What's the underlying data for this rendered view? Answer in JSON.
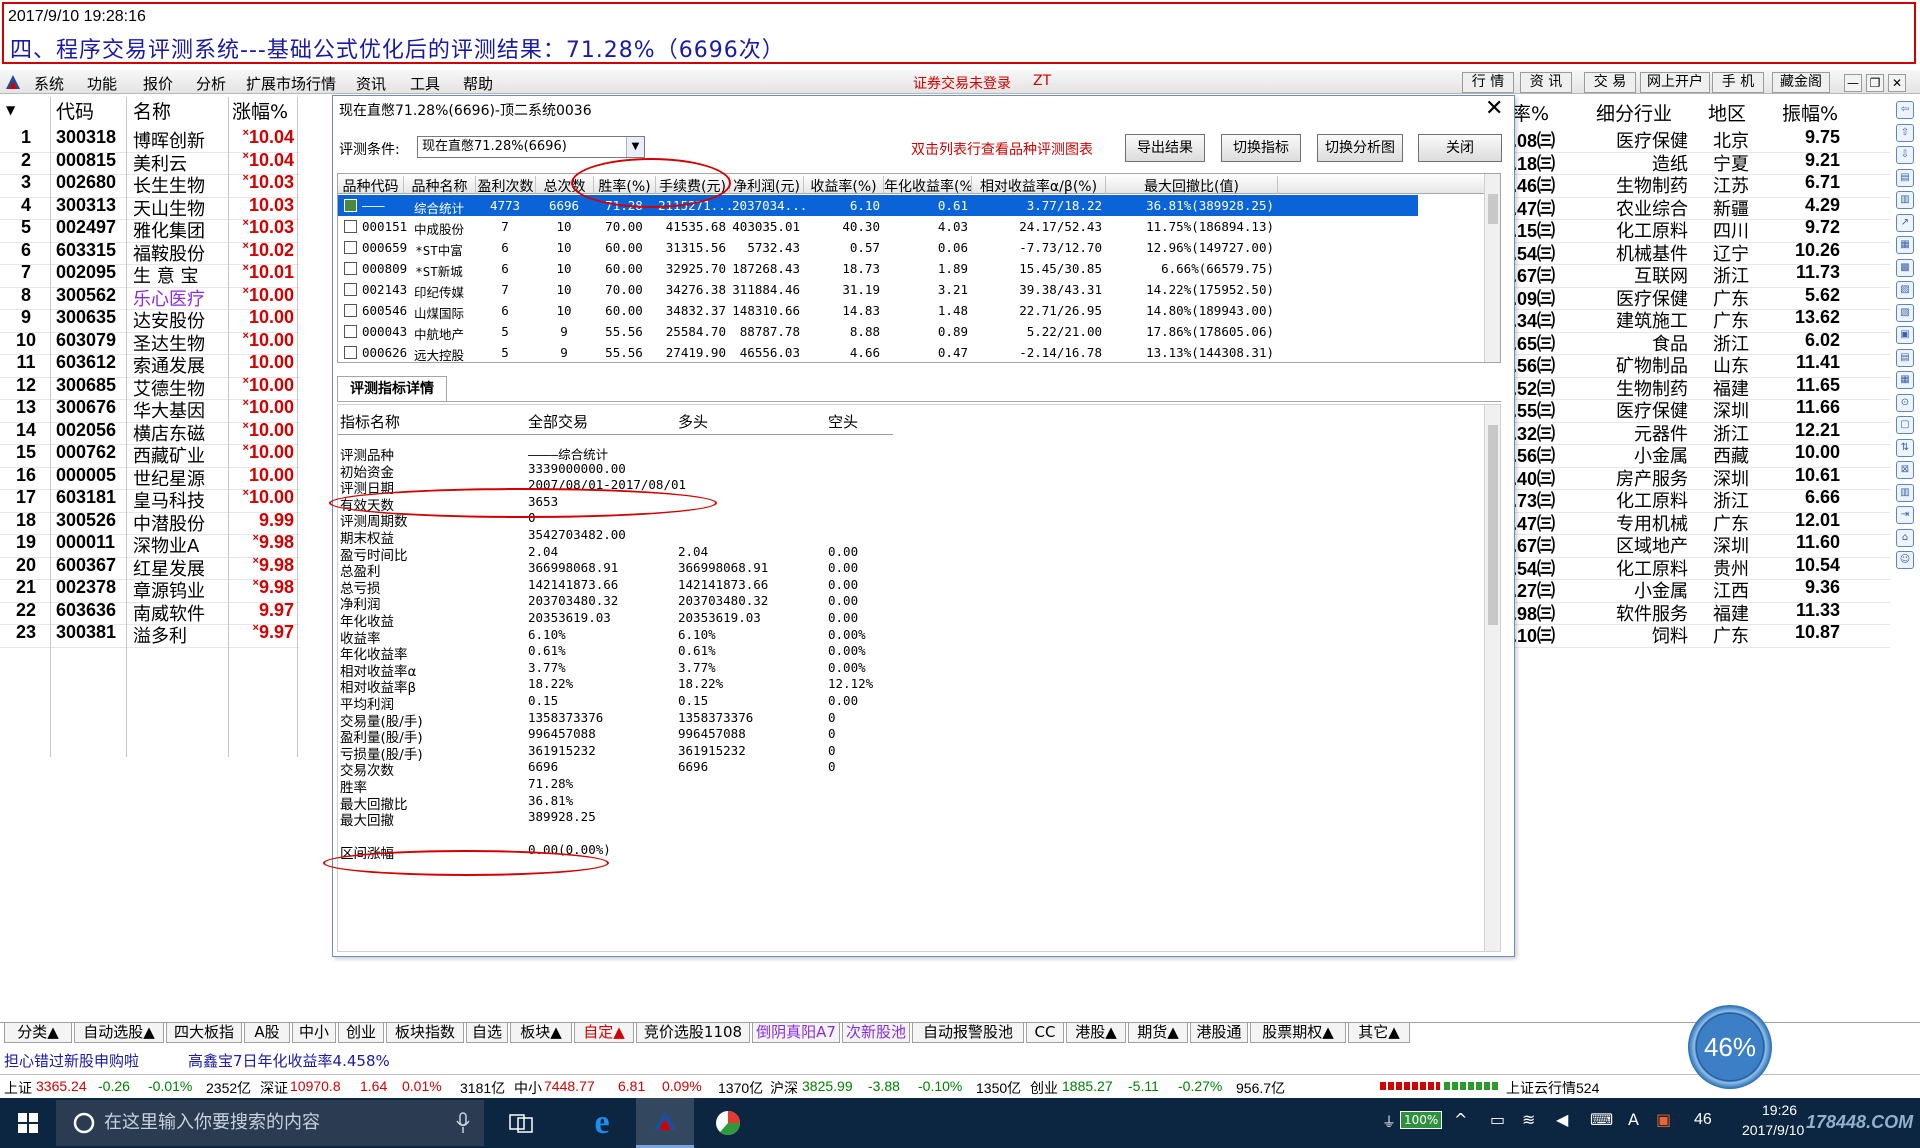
{
  "header": {
    "timestamp": "2017/9/10 19:28:16",
    "title": "四、程序交易评测系统---基础公式优化后的评测结果：71.28%（6696次）"
  },
  "menu": [
    "系统",
    "功能",
    "报价",
    "分析",
    "扩展市场行情",
    "资讯",
    "工具",
    "帮助"
  ],
  "login_notice": "证券交易未登录",
  "login_notice_extra": "ZT",
  "top_tabs": [
    "行 情",
    "资 讯",
    "交 易",
    "网上开户",
    "手 机",
    "藏金阁"
  ],
  "left_table": {
    "headers": [
      "代码",
      "名称",
      "涨幅%"
    ],
    "rows": [
      {
        "no": "1",
        "code": "300318",
        "name": "博晖创新",
        "pct": "10.04",
        "mark": "×"
      },
      {
        "no": "2",
        "code": "000815",
        "name": "美利云",
        "pct": "10.04",
        "mark": "×"
      },
      {
        "no": "3",
        "code": "002680",
        "name": "长生生物",
        "pct": "10.03",
        "mark": "×"
      },
      {
        "no": "4",
        "code": "300313",
        "name": "天山生物",
        "pct": "10.03",
        "mark": ""
      },
      {
        "no": "5",
        "code": "002497",
        "name": "雅化集团",
        "pct": "10.03",
        "mark": "×"
      },
      {
        "no": "6",
        "code": "603315",
        "name": "福鞍股份",
        "pct": "10.02",
        "mark": "×"
      },
      {
        "no": "7",
        "code": "002095",
        "name": "生 意 宝",
        "pct": "10.01",
        "mark": "×"
      },
      {
        "no": "8",
        "code": "300562",
        "name": "乐心医疗",
        "pct": "10.00",
        "mark": "×"
      },
      {
        "no": "9",
        "code": "300635",
        "name": "达安股份",
        "pct": "10.00",
        "mark": ""
      },
      {
        "no": "10",
        "code": "603079",
        "name": "圣达生物",
        "pct": "10.00",
        "mark": "×"
      },
      {
        "no": "11",
        "code": "603612",
        "name": "索通发展",
        "pct": "10.00",
        "mark": ""
      },
      {
        "no": "12",
        "code": "300685",
        "name": "艾德生物",
        "pct": "10.00",
        "mark": "×"
      },
      {
        "no": "13",
        "code": "300676",
        "name": "华大基因",
        "pct": "10.00",
        "mark": "×"
      },
      {
        "no": "14",
        "code": "002056",
        "name": "横店东磁",
        "pct": "10.00",
        "mark": "×"
      },
      {
        "no": "15",
        "code": "000762",
        "name": "西藏矿业",
        "pct": "10.00",
        "mark": "×"
      },
      {
        "no": "16",
        "code": "000005",
        "name": "世纪星源",
        "pct": "10.00",
        "mark": ""
      },
      {
        "no": "17",
        "code": "603181",
        "name": "皇马科技",
        "pct": "10.00",
        "mark": "×"
      },
      {
        "no": "18",
        "code": "300526",
        "name": "中潜股份",
        "pct": "9.99",
        "mark": ""
      },
      {
        "no": "19",
        "code": "000011",
        "name": "深物业A",
        "pct": "9.98",
        "mark": "×"
      },
      {
        "no": "20",
        "code": "600367",
        "name": "红星发展",
        "pct": "9.98",
        "mark": "×"
      },
      {
        "no": "21",
        "code": "002378",
        "name": "章源钨业",
        "pct": "9.98",
        "mark": "×"
      },
      {
        "no": "22",
        "code": "603636",
        "name": "南威软件",
        "pct": "9.97",
        "mark": ""
      },
      {
        "no": "23",
        "code": "300381",
        "name": "溢多利",
        "pct": "9.97",
        "mark": "×"
      }
    ],
    "highlight_name_color": "#8a2be2"
  },
  "right_table": {
    "headers": [
      "率%",
      "细分行业",
      "地区",
      "振幅%"
    ],
    "rows": [
      {
        "ret": ".08㈢",
        "ind": "医疗保健",
        "reg": "北京",
        "amp": "9.75"
      },
      {
        "ret": ".18㈢",
        "ind": "造纸",
        "reg": "宁夏",
        "amp": "9.21"
      },
      {
        "ret": ".46㈢",
        "ind": "生物制药",
        "reg": "江苏",
        "amp": "6.71"
      },
      {
        "ret": ".47㈢",
        "ind": "农业综合",
        "reg": "新疆",
        "amp": "4.29"
      },
      {
        "ret": ".15㈢",
        "ind": "化工原料",
        "reg": "四川",
        "amp": "9.72"
      },
      {
        "ret": ".54㈢",
        "ind": "机械基件",
        "reg": "辽宁",
        "amp": "10.26"
      },
      {
        "ret": ".67㈢",
        "ind": "互联网",
        "reg": "浙江",
        "amp": "11.73"
      },
      {
        "ret": ".09㈢",
        "ind": "医疗保健",
        "reg": "广东",
        "amp": "5.62"
      },
      {
        "ret": ".34㈢",
        "ind": "建筑施工",
        "reg": "广东",
        "amp": "13.62"
      },
      {
        "ret": ".65㈢",
        "ind": "食品",
        "reg": "浙江",
        "amp": "6.02"
      },
      {
        "ret": ".56㈢",
        "ind": "矿物制品",
        "reg": "山东",
        "amp": "11.41"
      },
      {
        "ret": ".52㈢",
        "ind": "生物制药",
        "reg": "福建",
        "amp": "11.65"
      },
      {
        "ret": ".55㈢",
        "ind": "医疗保健",
        "reg": "深圳",
        "amp": "11.66"
      },
      {
        "ret": ".32㈢",
        "ind": "元器件",
        "reg": "浙江",
        "amp": "12.21"
      },
      {
        "ret": ".56㈢",
        "ind": "小金属",
        "reg": "西藏",
        "amp": "10.00"
      },
      {
        "ret": ".40㈢",
        "ind": "房产服务",
        "reg": "深圳",
        "amp": "10.61"
      },
      {
        "ret": ".73㈢",
        "ind": "化工原料",
        "reg": "浙江",
        "amp": "6.66"
      },
      {
        "ret": ".47㈢",
        "ind": "专用机械",
        "reg": "广东",
        "amp": "12.01"
      },
      {
        "ret": ".67㈢",
        "ind": "区域地产",
        "reg": "深圳",
        "amp": "11.60"
      },
      {
        "ret": ".54㈢",
        "ind": "化工原料",
        "reg": "贵州",
        "amp": "10.54"
      },
      {
        "ret": ".27㈢",
        "ind": "小金属",
        "reg": "江西",
        "amp": "9.36"
      },
      {
        "ret": ".98㈢",
        "ind": "软件服务",
        "reg": "福建",
        "amp": "11.33"
      },
      {
        "ret": ".10㈢",
        "ind": "饲料",
        "reg": "广东",
        "amp": "10.87"
      }
    ]
  },
  "dialog": {
    "title": "现在直憋71.28%(6696)-顶二系统0036",
    "close": "✕",
    "cond_label": "评测条件:",
    "cond_value": "现在直憋71.28%(6696)",
    "tip": "双击列表行查看品种评测图表",
    "buttons": [
      "导出结果",
      "切换指标",
      "切换分析图",
      "关闭"
    ],
    "table_headers": [
      "品种代码",
      "品种名称",
      "盈利次数",
      "总次数",
      "胜率(%)",
      "手续费(元)",
      "净利润(元)",
      "收益率(%)",
      "年化收益率(%)",
      "相对收益率α/β(%)",
      "最大回撤比(值)"
    ],
    "table_rows": [
      [
        "———",
        "综合统计",
        "4773",
        "6696",
        "71.28",
        "2115271...",
        "2037034...",
        "6.10",
        "0.61",
        "3.77/18.22",
        "36.81%(389928.25)"
      ],
      [
        "000151",
        "中成股份",
        "7",
        "10",
        "70.00",
        "41535.68",
        "403035.01",
        "40.30",
        "4.03",
        "24.17/52.43",
        "11.75%(186894.13)"
      ],
      [
        "000659",
        "*ST中富",
        "6",
        "10",
        "60.00",
        "31315.56",
        "5732.43",
        "0.57",
        "0.06",
        "-7.73/12.70",
        "12.96%(149727.00)"
      ],
      [
        "000809",
        "*ST新城",
        "6",
        "10",
        "60.00",
        "32925.70",
        "187268.43",
        "18.73",
        "1.89",
        "15.45/30.85",
        "6.66%(66579.75)"
      ],
      [
        "002143",
        "印纪传媒",
        "7",
        "10",
        "70.00",
        "34276.38",
        "311884.46",
        "31.19",
        "3.21",
        "39.38/43.31",
        "14.22%(175952.50)"
      ],
      [
        "600546",
        "山煤国际",
        "6",
        "10",
        "60.00",
        "34832.37",
        "148310.66",
        "14.83",
        "1.48",
        "22.71/26.95",
        "14.80%(189943.00)"
      ],
      [
        "000043",
        "中航地产",
        "5",
        "9",
        "55.56",
        "25584.70",
        "88787.78",
        "8.88",
        "0.89",
        "5.22/21.00",
        "17.86%(178605.06)"
      ],
      [
        "000626",
        "远大控股",
        "5",
        "9",
        "55.56",
        "27419.90",
        "46556.03",
        "4.66",
        "0.47",
        "-2.14/16.78",
        "13.13%(144308.31)"
      ]
    ],
    "detail_tab": "评测指标详情",
    "detail_headers": [
      "指标名称",
      "全部交易",
      "多头",
      "空头"
    ],
    "detail_rows": [
      [
        "评测品种",
        "————综合统计",
        "",
        ""
      ],
      [
        "初始资金",
        "3339000000.00",
        "",
        ""
      ],
      [
        "评测日期",
        "2007/08/01-2017/08/01",
        "",
        ""
      ],
      [
        "有效天数",
        "3653",
        "",
        ""
      ],
      [
        "评测周期数",
        "0",
        "",
        ""
      ],
      [
        "期末权益",
        "3542703482.00",
        "",
        ""
      ],
      [
        "盈亏时间比",
        "2.04",
        "2.04",
        "0.00"
      ],
      [
        "总盈利",
        "366998068.91",
        "366998068.91",
        "0.00"
      ],
      [
        "总亏损",
        "142141873.66",
        "142141873.66",
        "0.00"
      ],
      [
        "净利润",
        "203703480.32",
        "203703480.32",
        "0.00"
      ],
      [
        "年化收益",
        "20353619.03",
        "20353619.03",
        "0.00"
      ],
      [
        "收益率",
        "6.10%",
        "6.10%",
        "0.00%"
      ],
      [
        "年化收益率",
        "0.61%",
        "0.61%",
        "0.00%"
      ],
      [
        "相对收益率α",
        "3.77%",
        "3.77%",
        "0.00%"
      ],
      [
        "相对收益率β",
        "18.22%",
        "18.22%",
        "12.12%"
      ],
      [
        "平均利润",
        "0.15",
        "0.15",
        "0.00"
      ],
      [
        "交易量(股/手)",
        "1358373376",
        "1358373376",
        "0"
      ],
      [
        "盈利量(股/手)",
        "996457088",
        "996457088",
        "0"
      ],
      [
        "亏损量(股/手)",
        "361915232",
        "361915232",
        "0"
      ],
      [
        "交易次数",
        "6696",
        "6696",
        "0"
      ],
      [
        "胜率",
        "71.28%",
        "",
        ""
      ],
      [
        "最大回撤比",
        "36.81%",
        "",
        ""
      ],
      [
        "最大回撤",
        "389928.25",
        "",
        ""
      ],
      [
        "",
        "",
        " ",
        ""
      ],
      [
        "区间涨幅",
        "0.00(0.00%)",
        "",
        ""
      ]
    ]
  },
  "bottom_tabs": [
    "分类▲",
    "自动选股▲",
    "四大板指",
    "A股",
    "中小",
    "创业",
    "板块指数",
    "自选",
    "板块▲",
    "自定▲",
    "竞价选股1108",
    "倒阴真阳A7",
    "次新股池",
    "自动报警股池",
    "CC",
    "港股▲",
    "期货▲",
    "港股通",
    "股票期权▲",
    "其它▲"
  ],
  "ticker": {
    "left": "担心错过新股申购啦",
    "right": "高鑫宝7日年化收益率4.458%"
  },
  "status": {
    "sh": "上证",
    "sh_val": "3365.24",
    "sh_chg": "-0.26",
    "sh_pct": "-0.01%",
    "sh_vol": "2352亿",
    "sz": "深证",
    "sz_val": "10970.8",
    "sz_chg": "1.64",
    "sz_pct": "0.01%",
    "sz_vol": "3181亿",
    "zx": "中小",
    "zx_val": "7448.77",
    "zx_chg": "6.81",
    "zx_pct": "0.09%",
    "zx_vol": "1370亿",
    "hs": "沪深",
    "hs_val": "3825.99",
    "hs_chg": "-3.88",
    "hs_pct": "-0.10%",
    "hs_vol": "1350亿",
    "cy": "创业",
    "cy_val": "1885.27",
    "cy_chg": "-5.11",
    "cy_pct": "-0.27%",
    "cy_vol": "956.7亿",
    "cloud": "上证云行情524"
  },
  "gauge": "46%",
  "taskbar": {
    "search": "在这里输入你要搜索的内容",
    "battery": "100%",
    "num": "46",
    "time": "19:26",
    "date": "2017/9/10",
    "watermark": "178448.COM"
  },
  "colors": {
    "red": "#d40000",
    "blue_title": "#1a1aa8",
    "select": "#0a64d8"
  }
}
